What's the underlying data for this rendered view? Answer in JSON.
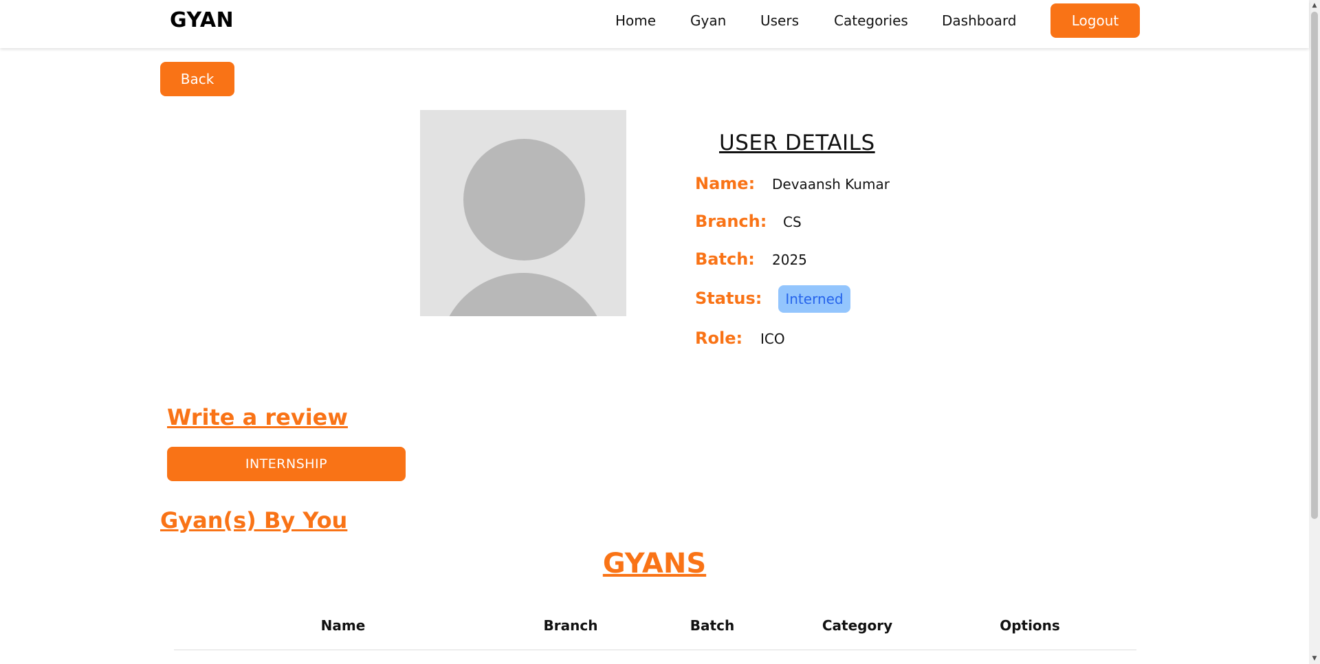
{
  "navbar": {
    "brand": "GYAN",
    "links": [
      "Home",
      "Gyan",
      "Users",
      "Categories",
      "Dashboard"
    ],
    "logout_label": "Logout"
  },
  "back_label": "Back",
  "user_details": {
    "title": "USER DETAILS",
    "fields": [
      {
        "label": "Name:",
        "value": "Devaansh Kumar"
      },
      {
        "label": "Branch:",
        "value": "CS"
      },
      {
        "label": "Batch:",
        "value": "2025"
      },
      {
        "label": "Status:",
        "value": "Interned"
      },
      {
        "label": "Role:",
        "value": "ICO"
      }
    ]
  },
  "review": {
    "heading": "Write a review",
    "button_label": "INTERNSHIP"
  },
  "gyans_by_you": "Gyan(s) By You",
  "gyans_table": {
    "title": "GYANS",
    "columns": [
      "Name",
      "Branch",
      "Batch",
      "Category",
      "Options"
    ]
  },
  "colors": {
    "accent": "#f97316",
    "status_bg": "#93c5fd",
    "status_text": "#2563eb"
  }
}
